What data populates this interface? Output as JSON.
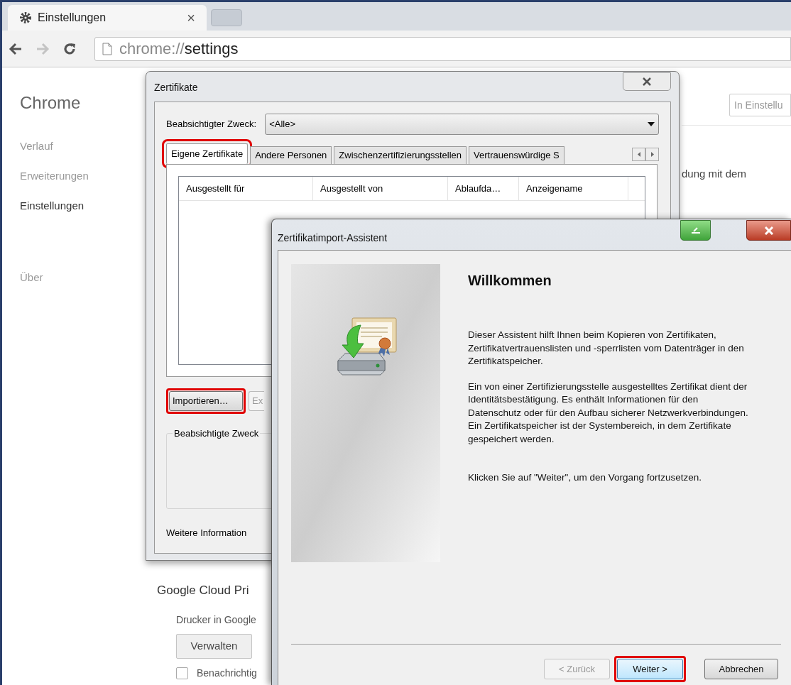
{
  "browser": {
    "tab": {
      "label": "Einstellungen",
      "close": "×",
      "selected": true
    },
    "nav_buttons": [
      {
        "kind": "back",
        "disabled": false
      },
      {
        "kind": "forward",
        "disabled": true
      },
      {
        "kind": "reload",
        "disabled": false
      }
    ],
    "address": {
      "scheme": "chrome://",
      "path": "settings"
    }
  },
  "sidebar": {
    "title": "Chrome",
    "items": [
      {
        "label": "Verlauf",
        "selected": false
      },
      {
        "label": "Erweiterungen",
        "selected": false
      },
      {
        "label": "Einstellungen",
        "selected": true
      },
      {
        "label": "Über",
        "selected": false
      }
    ]
  },
  "search": {
    "placeholder": "In Einstellu"
  },
  "settings_fragment": "dung mit dem",
  "cloud_print": {
    "heading": "Google Cloud Pri",
    "text": "Drucker in Google",
    "button": "Verwalten",
    "checkbox": {
      "label": "Benachrichtig",
      "checked": false
    }
  },
  "certificates_dialog": {
    "title": "Zertifikate",
    "purpose_label": "Beabsichtigter Zweck:",
    "purpose_value": "<Alle>",
    "tabs": [
      {
        "label": "Eigene Zertifikate",
        "selected": true,
        "highlighted": true
      },
      {
        "label": "Andere Personen",
        "selected": false,
        "highlighted": false
      },
      {
        "label": "Zwischenzertifizierungsstellen",
        "selected": false,
        "highlighted": false
      },
      {
        "label": "Vertrauenswürdige S",
        "selected": false,
        "highlighted": false
      }
    ],
    "columns": [
      "Ausgestellt für",
      "Ausgestellt von",
      "Ablaufda…",
      "Anzeigename"
    ],
    "buttons": [
      {
        "label": "Importieren…",
        "highlighted": true,
        "disabled": false
      },
      {
        "label": "Ex",
        "highlighted": false,
        "disabled": true
      }
    ],
    "group_label": "Beabsichtigte Zweck",
    "more_info": "Weitere Information"
  },
  "wizard": {
    "title": "Zertifikatimport-Assistent",
    "heading": "Willkommen",
    "paragraphs": [
      "Dieser Assistent hilft Ihnen beim Kopieren von Zertifikaten, Zertifikatvertrauenslisten und -sperrlisten vom Datenträger in den Zertifikatspeicher.",
      "Ein von einer Zertifizierungsstelle ausgestelltes Zertifikat dient der Identitätsbestätigung. Es enthält Informationen für den Datenschutz oder für den Aufbau sicherer Netzwerkverbindungen. Ein Zertifikatspeicher ist der Systembereich, in dem Zertifikate gespeichert werden.",
      "Klicken Sie auf \"Weiter\", um den Vorgang fortzusetzen."
    ],
    "buttons": [
      {
        "label": "< Zurück",
        "disabled": true,
        "focused": false,
        "highlighted": false
      },
      {
        "label": "Weiter >",
        "disabled": false,
        "focused": true,
        "highlighted": true
      },
      {
        "label": "Abbrechen",
        "disabled": false,
        "focused": false,
        "highlighted": false
      }
    ]
  }
}
